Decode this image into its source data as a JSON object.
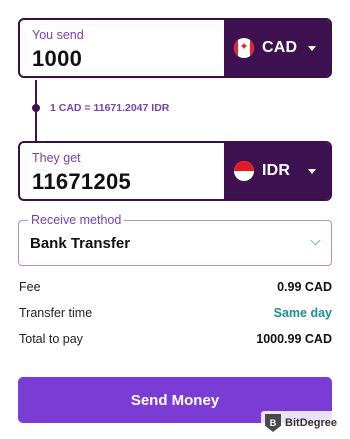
{
  "send": {
    "label": "You send",
    "amount": "1000",
    "currency": "CAD",
    "flag_icon": "canada-flag-icon"
  },
  "rate": {
    "text": "1 CAD = 11671.2047 IDR"
  },
  "get": {
    "label": "They get",
    "amount": "11671205",
    "currency": "IDR",
    "flag_icon": "indonesia-flag-icon"
  },
  "receive_method": {
    "label": "Receive method",
    "value": "Bank Transfer"
  },
  "summary": {
    "fee_label": "Fee",
    "fee_value": "0.99 CAD",
    "time_label": "Transfer time",
    "time_value": "Same day",
    "total_label": "Total to pay",
    "total_value": "1000.99 CAD"
  },
  "send_button_label": "Send Money",
  "watermark": "BitDegree",
  "colors": {
    "dark_purple": "#3e1150",
    "accent_purple": "#7b3cd6",
    "label_purple": "#7a3fb0",
    "teal": "#1c8f8f"
  }
}
